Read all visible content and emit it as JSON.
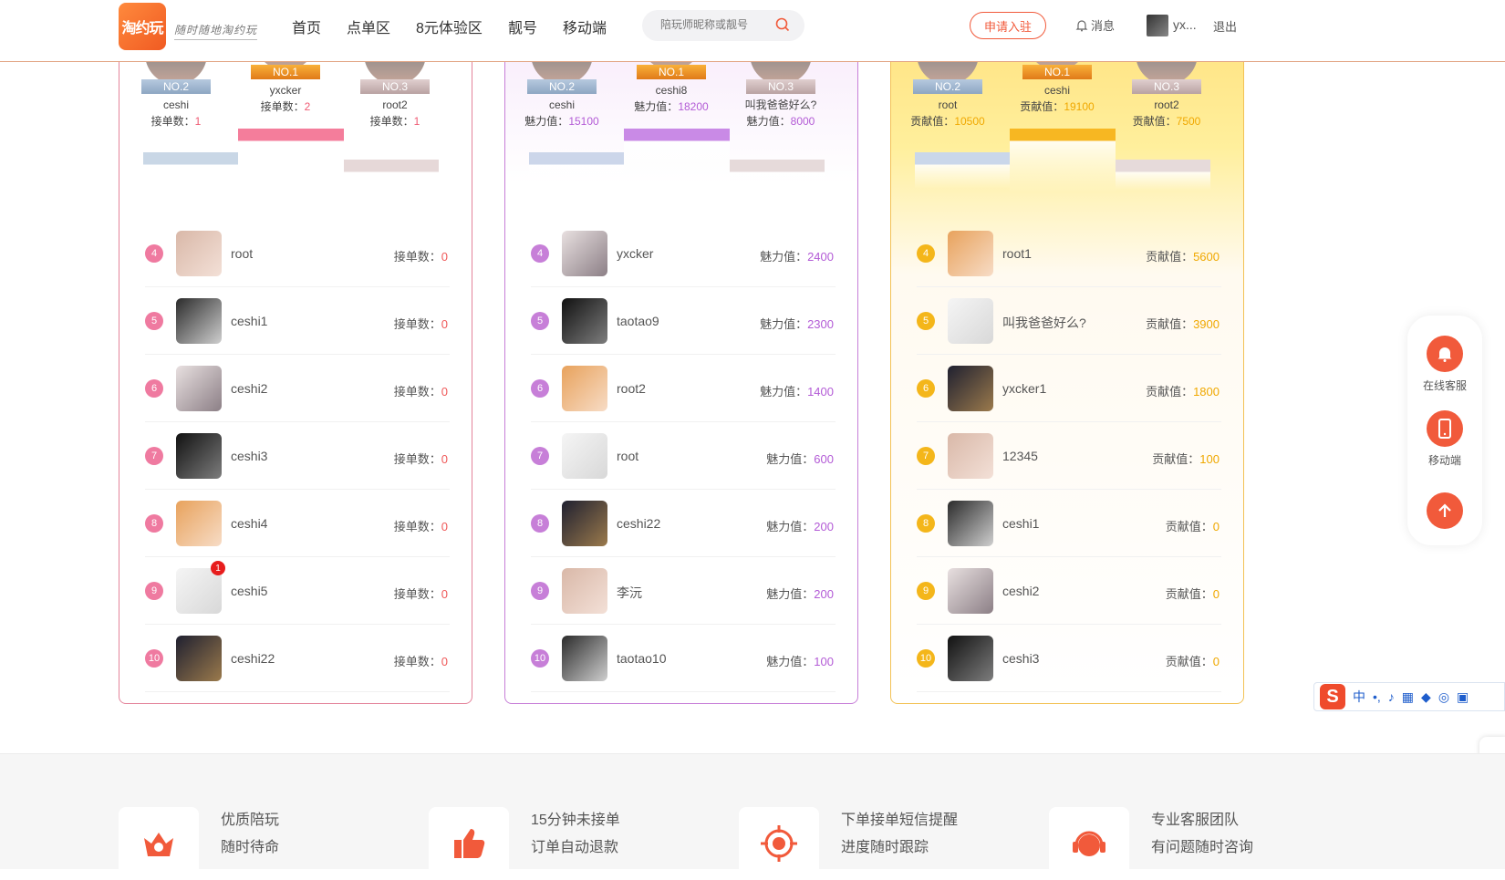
{
  "header": {
    "logo": "淘约玩",
    "slogan": "随时随地淘约玩",
    "nav": [
      "首页",
      "点单区",
      "8元体验区",
      "靓号",
      "移动端"
    ],
    "search_placeholder": "陪玩师昵称或靓号",
    "apply": "申请入驻",
    "message": "消息",
    "username": "yx...",
    "logout": "退出"
  },
  "boards": [
    {
      "theme": "pink",
      "podium": [
        {
          "rank_label": "NO.2",
          "name": "ceshi",
          "score_label": "接单数：",
          "score": "1"
        },
        {
          "rank_label": "NO.1",
          "name": "yxcker",
          "score_label": "接单数：",
          "score": "2"
        },
        {
          "rank_label": "NO.3",
          "name": "root2",
          "score_label": "接单数：",
          "score": "1"
        }
      ],
      "rows": [
        {
          "rank": "4",
          "name": "root",
          "label": "接单数：",
          "score": "0"
        },
        {
          "rank": "5",
          "name": "ceshi1",
          "label": "接单数：",
          "score": "0"
        },
        {
          "rank": "6",
          "name": "ceshi2",
          "label": "接单数：",
          "score": "0"
        },
        {
          "rank": "7",
          "name": "ceshi3",
          "label": "接单数：",
          "score": "0"
        },
        {
          "rank": "8",
          "name": "ceshi4",
          "label": "接单数：",
          "score": "0"
        },
        {
          "rank": "9",
          "name": "ceshi5",
          "label": "接单数：",
          "score": "0",
          "badge": "1"
        },
        {
          "rank": "10",
          "name": "ceshi22",
          "label": "接单数：",
          "score": "0"
        }
      ]
    },
    {
      "theme": "purple",
      "podium": [
        {
          "rank_label": "NO.2",
          "name": "ceshi",
          "score_label": "魅力值：",
          "score": "15100"
        },
        {
          "rank_label": "NO.1",
          "name": "ceshi8",
          "score_label": "魅力值：",
          "score": "18200"
        },
        {
          "rank_label": "NO.3",
          "name": "叫我爸爸好么?",
          "score_label": "魅力值：",
          "score": "8000"
        }
      ],
      "rows": [
        {
          "rank": "4",
          "name": "yxcker",
          "label": "魅力值：",
          "score": "2400"
        },
        {
          "rank": "5",
          "name": "taotao9",
          "label": "魅力值：",
          "score": "2300"
        },
        {
          "rank": "6",
          "name": "root2",
          "label": "魅力值：",
          "score": "1400"
        },
        {
          "rank": "7",
          "name": "root",
          "label": "魅力值：",
          "score": "600"
        },
        {
          "rank": "8",
          "name": "ceshi22",
          "label": "魅力值：",
          "score": "200"
        },
        {
          "rank": "9",
          "name": "李沅",
          "label": "魅力值：",
          "score": "200"
        },
        {
          "rank": "10",
          "name": "taotao10",
          "label": "魅力值：",
          "score": "100"
        }
      ]
    },
    {
      "theme": "gold",
      "podium": [
        {
          "rank_label": "NO.2",
          "name": "root",
          "score_label": "贡献值：",
          "score": "10500"
        },
        {
          "rank_label": "NO.1",
          "name": "ceshi",
          "score_label": "贡献值：",
          "score": "19100"
        },
        {
          "rank_label": "NO.3",
          "name": "root2",
          "score_label": "贡献值：",
          "score": "7500"
        }
      ],
      "rows": [
        {
          "rank": "4",
          "name": "root1",
          "label": "贡献值：",
          "score": "5600"
        },
        {
          "rank": "5",
          "name": "叫我爸爸好么?",
          "label": "贡献值：",
          "score": "3900"
        },
        {
          "rank": "6",
          "name": "yxcker1",
          "label": "贡献值：",
          "score": "1800"
        },
        {
          "rank": "7",
          "name": "12345",
          "label": "贡献值：",
          "score": "100"
        },
        {
          "rank": "8",
          "name": "ceshi1",
          "label": "贡献值：",
          "score": "0"
        },
        {
          "rank": "9",
          "name": "ceshi2",
          "label": "贡献值：",
          "score": "0"
        },
        {
          "rank": "10",
          "name": "ceshi3",
          "label": "贡献值：",
          "score": "0"
        }
      ]
    }
  ],
  "sidebar": {
    "service": "在线客服",
    "mobile": "移动端"
  },
  "ime": {
    "lang": "中"
  },
  "features": [
    {
      "line1": "优质陪玩",
      "line2": "随时待命"
    },
    {
      "line1": "15分钟未接单",
      "line2": "订单自动退款"
    },
    {
      "line1": "下单接单短信提醒",
      "line2": "进度随时跟踪"
    },
    {
      "line1": "专业客服团队",
      "line2": "有问题随时咨询"
    }
  ],
  "colors": {
    "accent": "#f15a3b",
    "pink": "#ef7aa0",
    "purple": "#c77fd8",
    "gold": "#f4b61a"
  }
}
